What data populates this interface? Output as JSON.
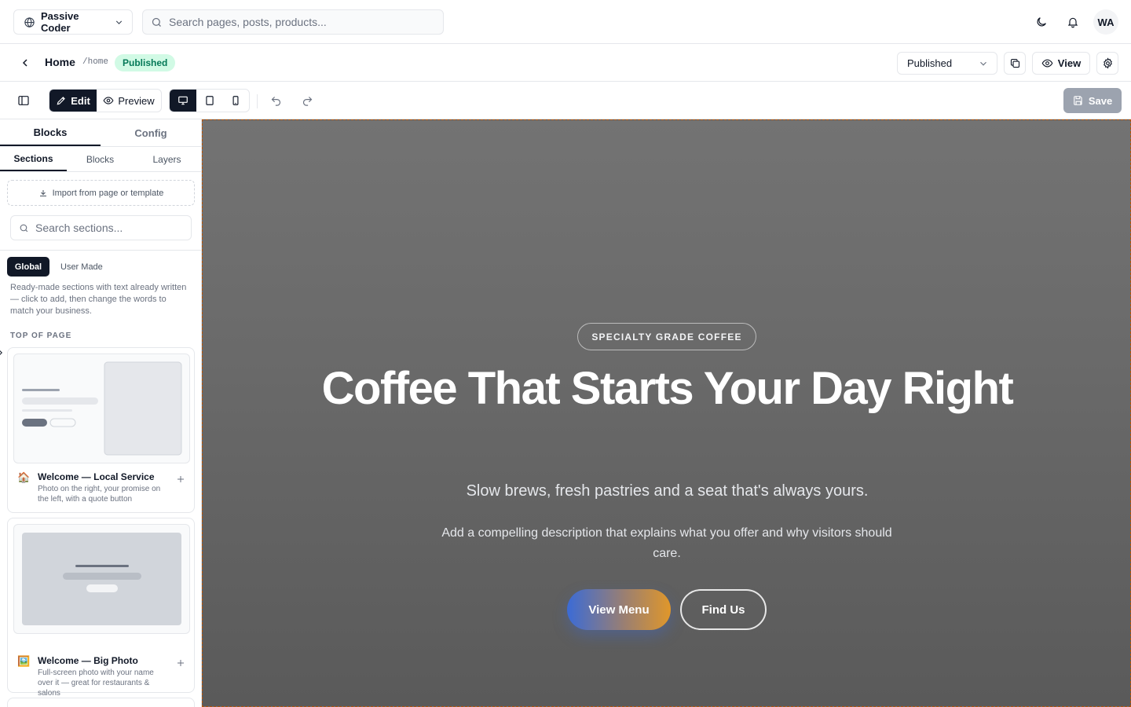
{
  "topbar": {
    "site_name": "Passive Coder",
    "search_placeholder": "Search pages, posts, products...",
    "avatar_initials": "WA"
  },
  "page_header": {
    "title": "Home",
    "slug": "/home",
    "status_badge": "Published",
    "status_select": "Published",
    "view_label": "View"
  },
  "toolbar": {
    "edit_label": "Edit",
    "preview_label": "Preview",
    "save_label": "Save",
    "active_device": "desktop"
  },
  "sidebar": {
    "main_tabs": [
      "Blocks",
      "Config"
    ],
    "sub_tabs": [
      "Sections",
      "Blocks",
      "Layers"
    ],
    "import_label": "Import from page or template",
    "search_placeholder": "Search sections...",
    "filters": [
      "Global",
      "User Made"
    ],
    "help_text": "Ready-made sections with text already written — click to add, then change the words to match your business.",
    "group_label": "TOP OF PAGE",
    "cards": [
      {
        "emoji": "🏠",
        "title": "Welcome — Local Service",
        "description": "Photo on the right, your promise on the left, with a quote button"
      },
      {
        "emoji": "🖼️",
        "title": "Welcome — Big Photo",
        "description": "Full-screen photo with your name over it — great for restaurants & salons"
      }
    ]
  },
  "hero": {
    "eyebrow": "SPECIALTY GRADE COFFEE",
    "title": "Coffee That Starts Your Day Right",
    "subtitle": "Slow brews, fresh pastries and a seat that's always yours.",
    "description": "Add a compelling description that explains what you offer and why visitors should care.",
    "primary_cta": "View Menu",
    "secondary_cta": "Find Us"
  },
  "colors": {
    "accent_dark": "#111827",
    "badge_bg": "#d1fae5",
    "badge_text": "#047857",
    "cta_gradient_start": "#3b6bd6",
    "cta_gradient_end": "#e0972a"
  }
}
